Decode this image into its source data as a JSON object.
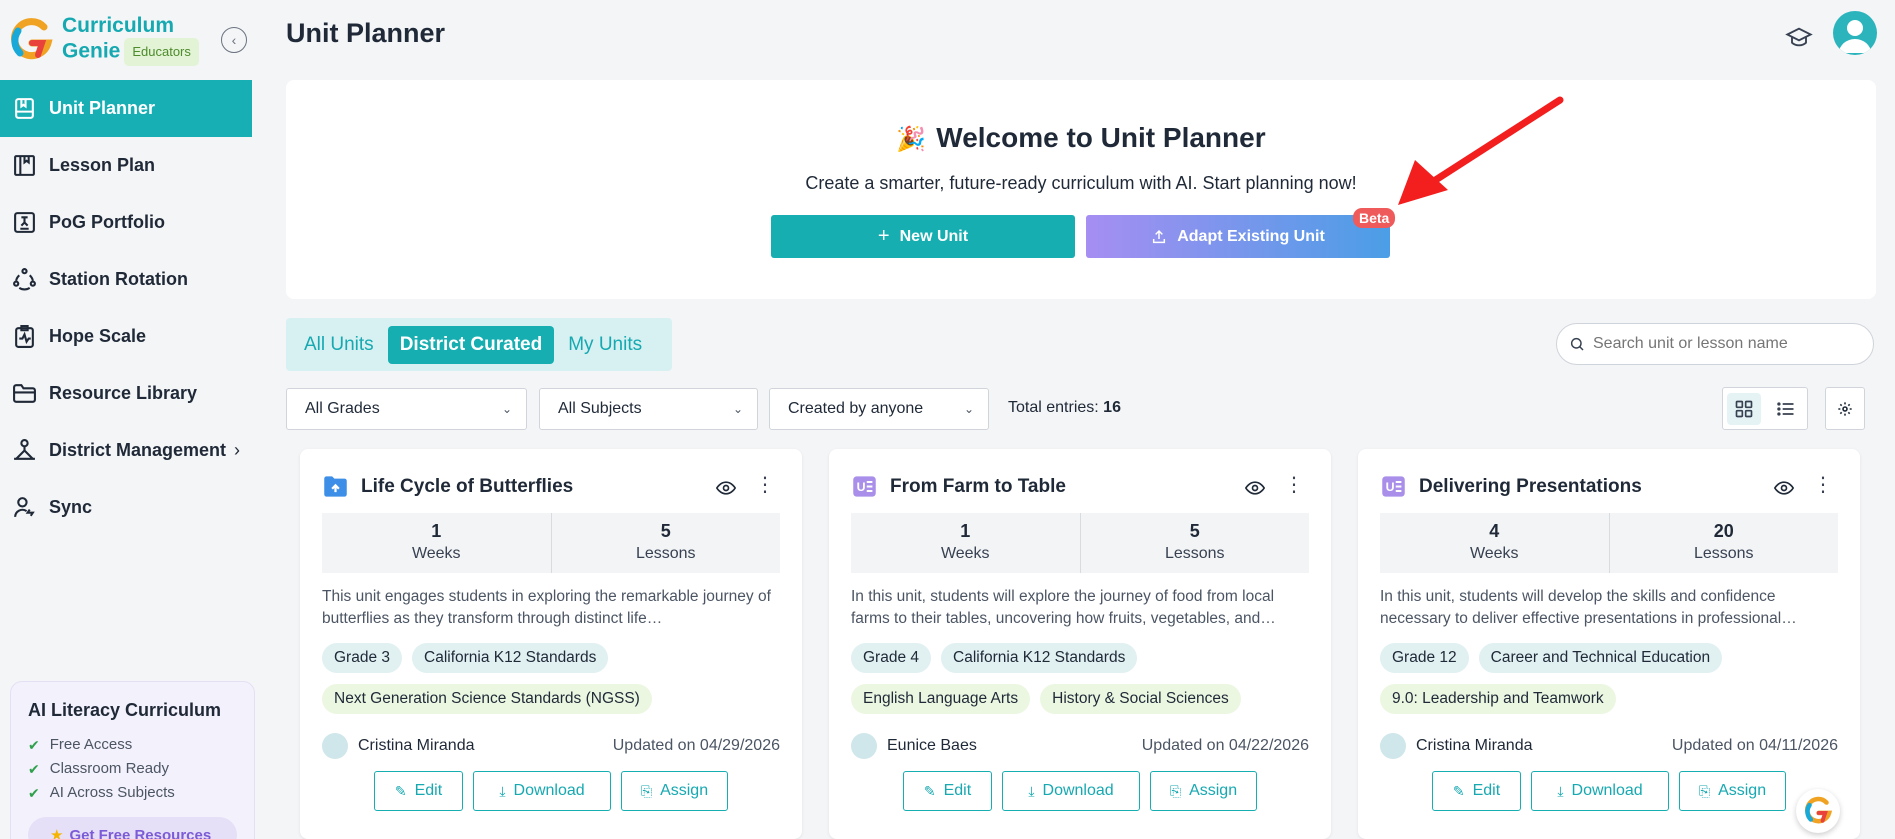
{
  "brand": {
    "line1": "Curriculum",
    "line2": "Genie",
    "badge": "Educators"
  },
  "sidebar": {
    "items": [
      {
        "label": "Unit Planner",
        "icon": "bookmark-book-icon",
        "active": true
      },
      {
        "label": "Lesson Plan",
        "icon": "book-icon"
      },
      {
        "label": "PoG Portfolio",
        "icon": "portfolio-icon"
      },
      {
        "label": "Station Rotation",
        "icon": "rotation-icon"
      },
      {
        "label": "Hope Scale",
        "icon": "clipboard-pulse-icon"
      },
      {
        "label": "Resource Library",
        "icon": "folder-icon"
      },
      {
        "label": "District Management",
        "icon": "hierarchy-icon",
        "has_submenu": true
      },
      {
        "label": "Sync",
        "icon": "user-sync-icon"
      }
    ]
  },
  "promo": {
    "title": "AI Literacy Curriculum",
    "items": [
      "Free Access",
      "Classroom Ready",
      "AI Across Subjects"
    ],
    "button": "Get Free Resources"
  },
  "header": {
    "title": "Unit Planner"
  },
  "welcome": {
    "title": "Welcome to Unit Planner",
    "subtitle": "Create a smarter, future-ready curriculum with AI. Start planning now!",
    "new_unit": "New Unit",
    "adapt_unit": "Adapt Existing Unit",
    "beta": "Beta"
  },
  "tabs": [
    {
      "label": "All Units",
      "active": false
    },
    {
      "label": "District Curated",
      "active": true
    },
    {
      "label": "My Units",
      "active": false
    }
  ],
  "search": {
    "placeholder": "Search unit or lesson name"
  },
  "filters": {
    "grades": "All Grades",
    "subjects": "All Subjects",
    "creator": "Created by anyone",
    "total_label": "Total entries:",
    "total_value": "16"
  },
  "cards": [
    {
      "title": "Life Cycle of Butterflies",
      "icon": "folder-upload-icon",
      "weeks": "1",
      "weeks_label": "Weeks",
      "lessons": "5",
      "lessons_label": "Lessons",
      "description": "This unit engages students in exploring the remarkable journey of butterflies as they transform through distinct life…",
      "tags": [
        {
          "text": "Grade 3",
          "color": "blue"
        },
        {
          "text": "California K12 Standards",
          "color": "blue"
        },
        {
          "text": "Next Generation Science Standards (NGSS)",
          "color": "green"
        }
      ],
      "author": "Cristina Miranda",
      "updated": "Updated on 04/29/2026"
    },
    {
      "title": "From Farm to Table",
      "icon": "unit-doc-icon",
      "weeks": "1",
      "weeks_label": "Weeks",
      "lessons": "5",
      "lessons_label": "Lessons",
      "description": "In this unit, students will explore the journey of food from local farms to their tables, uncovering how fruits, vegetables, and…",
      "tags": [
        {
          "text": "Grade 4",
          "color": "blue"
        },
        {
          "text": "California K12 Standards",
          "color": "blue"
        },
        {
          "text": "English Language Arts",
          "color": "green"
        },
        {
          "text": "History & Social Sciences",
          "color": "green"
        }
      ],
      "author": "Eunice Baes",
      "updated": "Updated on 04/22/2026"
    },
    {
      "title": "Delivering Presentations",
      "icon": "unit-doc-icon",
      "weeks": "4",
      "weeks_label": "Weeks",
      "lessons": "20",
      "lessons_label": "Lessons",
      "description": "In this unit, students will develop the skills and confidence necessary to deliver effective presentations in professional…",
      "tags": [
        {
          "text": "Grade 12",
          "color": "blue"
        },
        {
          "text": "Career and Technical Education",
          "color": "blue"
        },
        {
          "text": "9.0: Leadership and Teamwork",
          "color": "green"
        }
      ],
      "author": "Cristina Miranda",
      "updated": "Updated on 04/11/2026"
    }
  ],
  "card_actions": {
    "edit": "Edit",
    "download": "Download",
    "assign": "Assign"
  },
  "colors": {
    "accent": "#16aeb1",
    "beta": "#ef5a5a",
    "arrow": "#f31e1e"
  }
}
